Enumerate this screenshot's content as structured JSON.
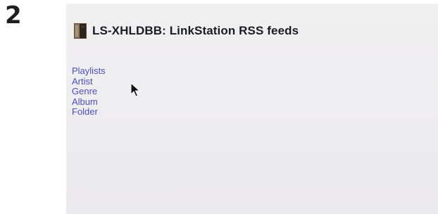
{
  "step_number": "2",
  "screen": {
    "title": "LS-XHLDBB: LinkStation RSS feeds",
    "logo_icon": "linkstation-device-icon",
    "menu_items": [
      {
        "label": "Playlists"
      },
      {
        "label": "Artist"
      },
      {
        "label": "Genre"
      },
      {
        "label": "Album"
      },
      {
        "label": "Folder"
      }
    ],
    "pointer_icon": "mouse-pointer-icon"
  },
  "colors": {
    "link": "#4a4fc4",
    "title": "#1b1b24",
    "screen_background": "#eeedef",
    "step_number": "#231f20"
  }
}
